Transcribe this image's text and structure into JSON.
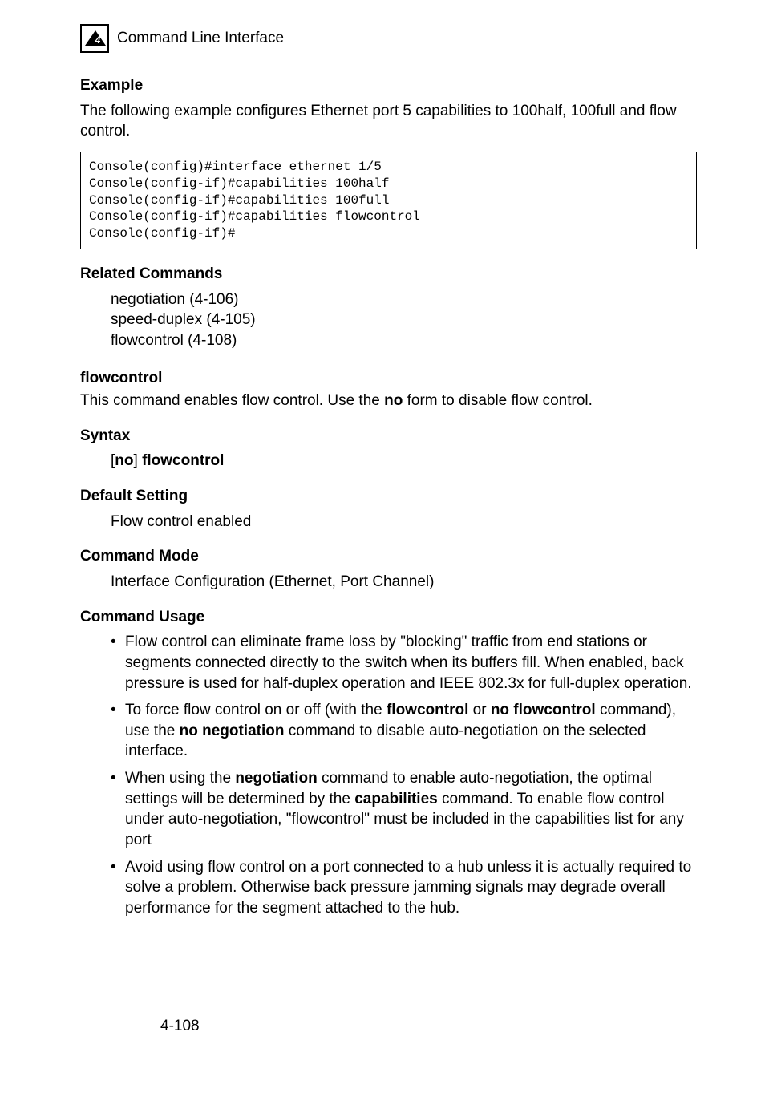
{
  "header": {
    "chapter_num": "4",
    "running_title": "Command Line Interface"
  },
  "example": {
    "heading": "Example",
    "para": "The following example configures Ethernet port 5 capabilities to 100half, 100full and flow control.",
    "code": "Console(config)#interface ethernet 1/5\nConsole(config-if)#capabilities 100half\nConsole(config-if)#capabilities 100full\nConsole(config-if)#capabilities flowcontrol\nConsole(config-if)#"
  },
  "related": {
    "heading": "Related Commands",
    "lines": [
      "negotiation (4-106)",
      "speed-duplex (4-105)",
      "flowcontrol (4-108)"
    ]
  },
  "cmd": {
    "name": "flowcontrol",
    "desc_pre": "This command enables flow control. Use the ",
    "desc_bold": "no",
    "desc_post": " form to disable flow control."
  },
  "syntax": {
    "heading": "Syntax",
    "open_br": "[",
    "no": "no",
    "close_br": "] ",
    "cmdword": "flowcontrol"
  },
  "default": {
    "heading": "Default Setting",
    "text": "Flow control enabled"
  },
  "mode": {
    "heading": "Command Mode",
    "text": "Interface Configuration (Ethernet, Port Channel)"
  },
  "usage": {
    "heading": "Command Usage",
    "items": [
      {
        "segments": [
          {
            "t": "Flow control can eliminate frame loss by \"blocking\" traffic from end stations or segments connected directly to the switch when its buffers fill. When enabled, back pressure is used for half-duplex operation and IEEE 802.3x for full-duplex operation."
          }
        ]
      },
      {
        "segments": [
          {
            "t": "To force flow control on or off (with the "
          },
          {
            "t": "flowcontrol",
            "b": true
          },
          {
            "t": " or "
          },
          {
            "t": "no flowcontrol",
            "b": true
          },
          {
            "t": " command), use the "
          },
          {
            "t": "no negotiation",
            "b": true
          },
          {
            "t": " command to disable auto-negotiation on the selected interface."
          }
        ]
      },
      {
        "segments": [
          {
            "t": "When using the "
          },
          {
            "t": "negotiation",
            "b": true
          },
          {
            "t": " command to enable auto-negotiation, the optimal settings will be determined by the "
          },
          {
            "t": "capabilities",
            "b": true
          },
          {
            "t": " command. To enable flow control under auto-negotiation, \"flowcontrol\" must be included in the capabilities list for any port"
          }
        ]
      },
      {
        "segments": [
          {
            "t": "Avoid using flow control on a port connected to a hub unless it is actually required to solve a problem. Otherwise back pressure jamming signals may degrade overall performance for the segment attached to the hub."
          }
        ]
      }
    ]
  },
  "footer": {
    "page_number": "4-108"
  }
}
